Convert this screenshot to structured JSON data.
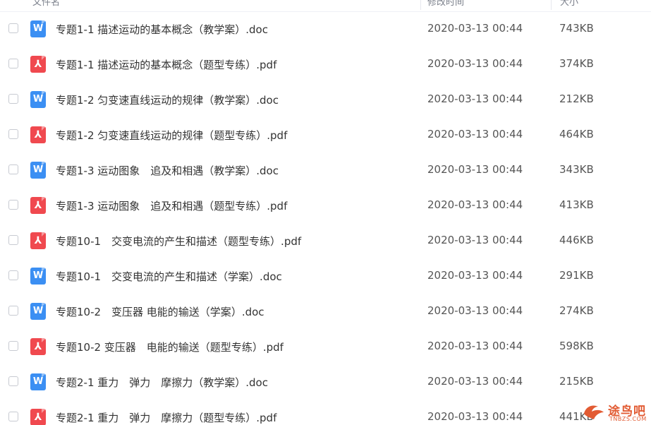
{
  "header": {
    "name_label": "文件名",
    "time_label": "修改时间",
    "size_label": "大小"
  },
  "files": [
    {
      "type": "word",
      "icon_letter": "W",
      "name": "专题1-1 描述运动的基本概念（教学案）.doc",
      "time": "2020-03-13 00:44",
      "size": "743KB"
    },
    {
      "type": "pdf",
      "icon_letter": "⅄",
      "name": "专题1-1 描述运动的基本概念（题型专练）.pdf",
      "time": "2020-03-13 00:44",
      "size": "374KB"
    },
    {
      "type": "word",
      "icon_letter": "W",
      "name": "专题1-2 匀变速直线运动的规律（教学案）.doc",
      "time": "2020-03-13 00:44",
      "size": "212KB"
    },
    {
      "type": "pdf",
      "icon_letter": "⅄",
      "name": "专题1-2 匀变速直线运动的规律（题型专练）.pdf",
      "time": "2020-03-13 00:44",
      "size": "464KB"
    },
    {
      "type": "word",
      "icon_letter": "W",
      "name": "专题1-3 运动图象　追及和相遇（教学案）.doc",
      "time": "2020-03-13 00:44",
      "size": "343KB"
    },
    {
      "type": "pdf",
      "icon_letter": "⅄",
      "name": "专题1-3 运动图象　追及和相遇（题型专练）.pdf",
      "time": "2020-03-13 00:44",
      "size": "413KB"
    },
    {
      "type": "pdf",
      "icon_letter": "⅄",
      "name": "专题10-1　交变电流的产生和描述（题型专练）.pdf",
      "time": "2020-03-13 00:44",
      "size": "446KB"
    },
    {
      "type": "word",
      "icon_letter": "W",
      "name": "专题10-1　交变电流的产生和描述（学案）.doc",
      "time": "2020-03-13 00:44",
      "size": "291KB"
    },
    {
      "type": "word",
      "icon_letter": "W",
      "name": "专题10-2　变压器 电能的输送（学案）.doc",
      "time": "2020-03-13 00:44",
      "size": "274KB"
    },
    {
      "type": "pdf",
      "icon_letter": "⅄",
      "name": "专题10-2 变压器　电能的输送（题型专练）.pdf",
      "time": "2020-03-13 00:44",
      "size": "598KB"
    },
    {
      "type": "word",
      "icon_letter": "W",
      "name": "专题2-1 重力　弹力　摩擦力（教学案）.doc",
      "time": "2020-03-13 00:44",
      "size": "215KB"
    },
    {
      "type": "pdf",
      "icon_letter": "⅄",
      "name": "专题2-1 重力　弹力　摩擦力（题型专练）.pdf",
      "time": "2020-03-13 00:44",
      "size": "441KB"
    }
  ],
  "watermark": {
    "text": "途鸟吧",
    "sub": "TNBZS.COM"
  },
  "colors": {
    "word_icon": "#3b8ff3",
    "pdf_icon": "#f0494f",
    "sort_accent": "#06a7ff",
    "watermark": "#e25b33"
  }
}
